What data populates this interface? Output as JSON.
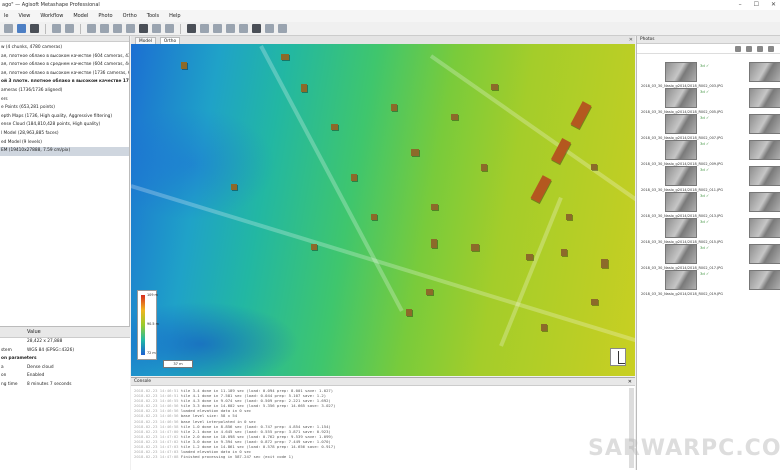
{
  "window": {
    "title": "ago\" — Agisoft Metashape Professional",
    "controls": [
      "–",
      "☐",
      "✕"
    ]
  },
  "menu": [
    "le",
    "View",
    "Workflow",
    "Model",
    "Photo",
    "Ortho",
    "Tools",
    "Help"
  ],
  "workspace": {
    "items": [
      {
        "text": "w (4 chunks, 4780 cameras)",
        "style": "normal"
      },
      {
        "text": "ая, плотное облако в высоком качестве (604 cameras, 435,877 points) [R]",
        "style": "normal"
      },
      {
        "text": "ая, плотное облако в среднем качестве (604 cameras, 442,395 points) [R]",
        "style": "normal"
      },
      {
        "text": "ая, плотное облако в высоком качестве (1736 cameras, 633,202 points) [R]",
        "style": "normal"
      },
      {
        "text": "ой 3 плотн. плотное облако в высоком качестве 1736 камер (1736 cameras, 2",
        "style": "bold"
      },
      {
        "text": "ameras (1736/1736 aligned)",
        "style": "normal"
      },
      {
        "text": "ers",
        "style": "normal"
      },
      {
        "text": "e Points (653,281 points)",
        "style": "normal"
      },
      {
        "text": "epth Maps (1736, High quality, Aggressive filtering)",
        "style": "normal"
      },
      {
        "text": "ense Cloud (184,810,428 points, High quality)",
        "style": "normal"
      },
      {
        "text": "l Model (28,963,885 faces)",
        "style": "normal"
      },
      {
        "text": "ed Model (9 levels)",
        "style": "normal"
      },
      {
        "text": "EM (19410x27888, 7.59 cm/pix)",
        "style": "selected"
      }
    ]
  },
  "properties": {
    "header": "Value",
    "rows": [
      {
        "k": "",
        "v": "28,422 x 27,888",
        "head": false
      },
      {
        "k": "stem",
        "v": "WGS 84 (EPSG::4326)",
        "head": false
      },
      {
        "k": "on parameters",
        "v": "",
        "head": true
      },
      {
        "k": "a",
        "v": "Dense cloud",
        "head": false
      },
      {
        "k": "on",
        "v": "Enabled",
        "head": false
      },
      {
        "k": "ng time",
        "v": "8 minutes 7 seconds",
        "head": false
      }
    ]
  },
  "view_tabs": [
    {
      "label": "Model",
      "active": false
    },
    {
      "label": "Ortho",
      "active": true
    }
  ],
  "legend": {
    "top": "109 m",
    "mid": "90.5 m",
    "bottom": "72 m"
  },
  "scale_label": "37 m",
  "console": {
    "title": "Console",
    "lines": [
      {
        "ts": "2018-02-23 14:46:51",
        "msg": "tile 3-4 done in 11.189 sec (load: 0.094 prep: 8.001 save: 1.027)"
      },
      {
        "ts": "2018-02-23 14:46:51",
        "msg": "tile 4-1 done in 7.581 sec (load: 0.044 prep: 5.107 save: 1.2)"
      },
      {
        "ts": "2018-02-23 14:46:55",
        "msg": "tile 4-3 done in 9.074 sec (load: 0.509 prep: 2.221 save: 1.692)"
      },
      {
        "ts": "2018-02-23 14:46:56",
        "msg": "tile 3-3 done in 14.602 sec (load: 5.356 prep: 14.665 save: 3.027)"
      },
      {
        "ts": "2018-02-23 14:46:56",
        "msg": "loaded elevation data in 0 sec"
      },
      {
        "ts": "2018-02-23 14:46:56",
        "msg": "base level size: 58 x 54"
      },
      {
        "ts": "2018-02-23 14:46:56",
        "msg": "base level interpolated in 0 sec"
      },
      {
        "ts": "2018-02-23 14:46:58",
        "msg": "tile 1-0 done in 8.856 sec (load: 0.747 prep: 4.854 save: 1.154)"
      },
      {
        "ts": "2018-02-23 14:47:00",
        "msg": "tile 2-1 done in 4.645 sec (load: 0.555 prep: 3.871 save: 0.923)"
      },
      {
        "ts": "2018-02-23 14:47:02",
        "msg": "tile 2-0 done in 10.098 sec (load: 0.762 prep: 9.539 save: 1.099)"
      },
      {
        "ts": "2018-02-23 14:47:02",
        "msg": "tile 3-0 done in 9.394 sec (load: 0.872 prep: 7.449 save: 1.070)"
      },
      {
        "ts": "2018-02-23 14:47:03",
        "msg": "tile 1-2 done in 14.861 sec (load: 0.578 prep: 14.656 save: 0.917)"
      },
      {
        "ts": "2018-02-23 14:47:03",
        "msg": "loaded elevation data in 0 sec"
      },
      {
        "ts": "2018-02-23 14:47:08",
        "msg": "Finished processing in 587.247 sec (exit code 1)"
      }
    ]
  },
  "photos": {
    "title": "Photos",
    "check": "3d ✓",
    "captions": [
      "2018_03_30_Naslo_g2014/2018_R002_003.JPG",
      "2018_03_30_Naslo_g2014/2018_R002_005.JPG",
      "2018_03_30_Naslo_g2014/2018_R002_007.JPG",
      "2018_03_30_Naslo_g2014/2018_R002_009.JPG",
      "2018_03_30_Naslo_g2014/2018_R002_011.JPG",
      "2018_03_30_Naslo_g2014/2018_R002_013.JPG",
      "2018_03_30_Naslo_g2014/2018_R002_015.JPG",
      "2018_03_30_Naslo_g2014/2018_R002_017.JPG",
      "2018_03_30_Naslo_g2014/2018_R002_019.JPG"
    ]
  },
  "watermark": "SARWARPC.COM"
}
